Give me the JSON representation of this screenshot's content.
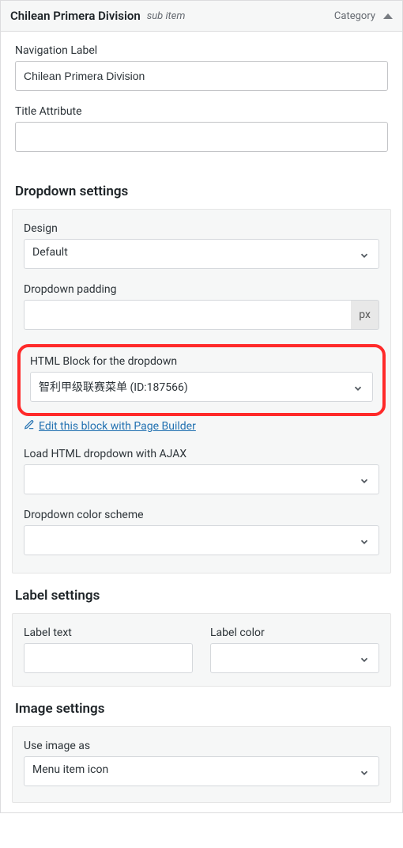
{
  "header": {
    "title": "Chilean Primera Division",
    "sub_item": "sub item",
    "type_label": "Category"
  },
  "nav_label": {
    "label": "Navigation Label",
    "value": "Chilean Primera Division"
  },
  "title_attr": {
    "label": "Title Attribute",
    "value": ""
  },
  "dropdown_settings": {
    "title": "Dropdown settings",
    "design": {
      "label": "Design",
      "value": "Default"
    },
    "padding": {
      "label": "Dropdown padding",
      "value": "",
      "unit": "px"
    },
    "html_block": {
      "label": "HTML Block for the dropdown",
      "value": "智利甲级联赛菜单 (ID:187566)"
    },
    "edit_link": "Edit this block with Page Builder",
    "ajax": {
      "label": "Load HTML dropdown with AJAX",
      "value": ""
    },
    "color_scheme": {
      "label": "Dropdown color scheme",
      "value": ""
    }
  },
  "label_settings": {
    "title": "Label settings",
    "text": {
      "label": "Label text",
      "value": ""
    },
    "color": {
      "label": "Label color",
      "value": ""
    }
  },
  "image_settings": {
    "title": "Image settings",
    "use_as": {
      "label": "Use image as",
      "value": "Menu item icon"
    }
  }
}
